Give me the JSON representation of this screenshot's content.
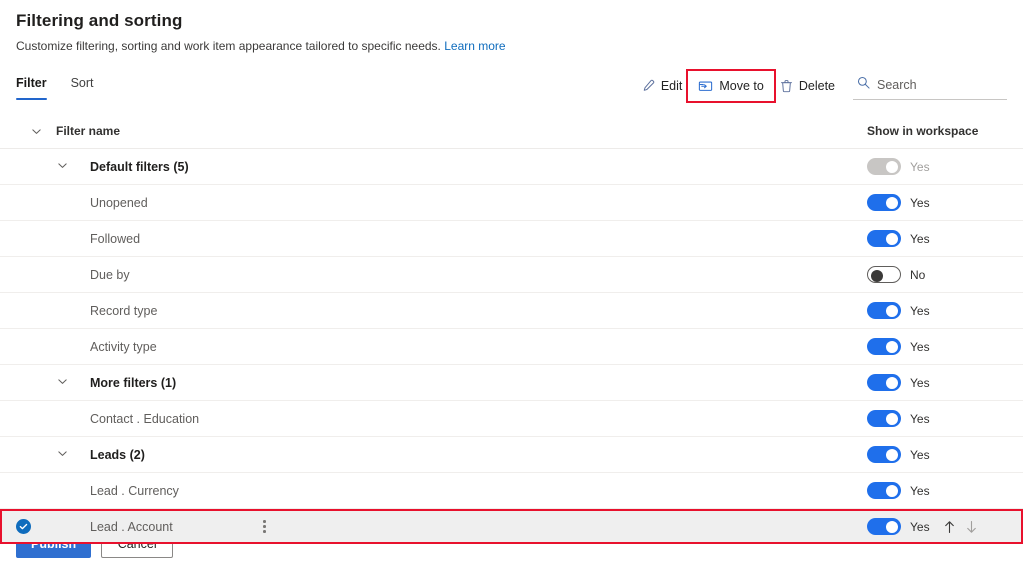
{
  "header": {
    "title": "Filtering and sorting",
    "subtitle": "Customize filtering, sorting and work item appearance tailored to specific needs.",
    "learn_more": "Learn more"
  },
  "tabs": [
    {
      "label": "Filter",
      "active": true
    },
    {
      "label": "Sort",
      "active": false
    }
  ],
  "commands": [
    {
      "label": "Edit",
      "icon": "pencil-icon",
      "highlighted": false
    },
    {
      "label": "Move to",
      "icon": "move-to-folder-icon",
      "highlighted": true
    },
    {
      "label": "Delete",
      "icon": "trash-icon",
      "highlighted": false
    }
  ],
  "search": {
    "placeholder": "Search",
    "value": "",
    "icon": "search-icon"
  },
  "table": {
    "columns": {
      "name": "Filter name",
      "workspace": "Show in workspace"
    },
    "rows": [
      {
        "label": "Default filters (5)",
        "type": "group",
        "chevron": true,
        "toggle": "disabled",
        "toggle_label": "Yes",
        "selected": false
      },
      {
        "label": "Unopened",
        "type": "item",
        "chevron": false,
        "toggle": "on",
        "toggle_label": "Yes",
        "selected": false
      },
      {
        "label": "Followed",
        "type": "item",
        "chevron": false,
        "toggle": "on",
        "toggle_label": "Yes",
        "selected": false
      },
      {
        "label": "Due by",
        "type": "item",
        "chevron": false,
        "toggle": "off",
        "toggle_label": "No",
        "selected": false
      },
      {
        "label": "Record type",
        "type": "item",
        "chevron": false,
        "toggle": "on",
        "toggle_label": "Yes",
        "selected": false
      },
      {
        "label": "Activity type",
        "type": "item",
        "chevron": false,
        "toggle": "on",
        "toggle_label": "Yes",
        "selected": false
      },
      {
        "label": "More filters (1)",
        "type": "group",
        "chevron": true,
        "toggle": "on",
        "toggle_label": "Yes",
        "selected": false
      },
      {
        "label": "Contact . Education",
        "type": "item",
        "chevron": false,
        "toggle": "on",
        "toggle_label": "Yes",
        "selected": false
      },
      {
        "label": "Leads (2)",
        "type": "group",
        "chevron": true,
        "toggle": "on",
        "toggle_label": "Yes",
        "selected": false
      },
      {
        "label": "Lead . Currency",
        "type": "item",
        "chevron": false,
        "toggle": "on",
        "toggle_label": "Yes",
        "selected": false
      },
      {
        "label": "Lead . Account",
        "type": "item",
        "chevron": false,
        "toggle": "on",
        "toggle_label": "Yes",
        "selected": true
      }
    ]
  },
  "footer": {
    "publish": "Publish",
    "cancel": "Cancel"
  },
  "colors": {
    "accent": "#2266cc",
    "toggle_on": "#1f6feb",
    "primary_button": "#2f6fd0",
    "link": "#0f6cbd",
    "annotation": "#e8112d"
  }
}
